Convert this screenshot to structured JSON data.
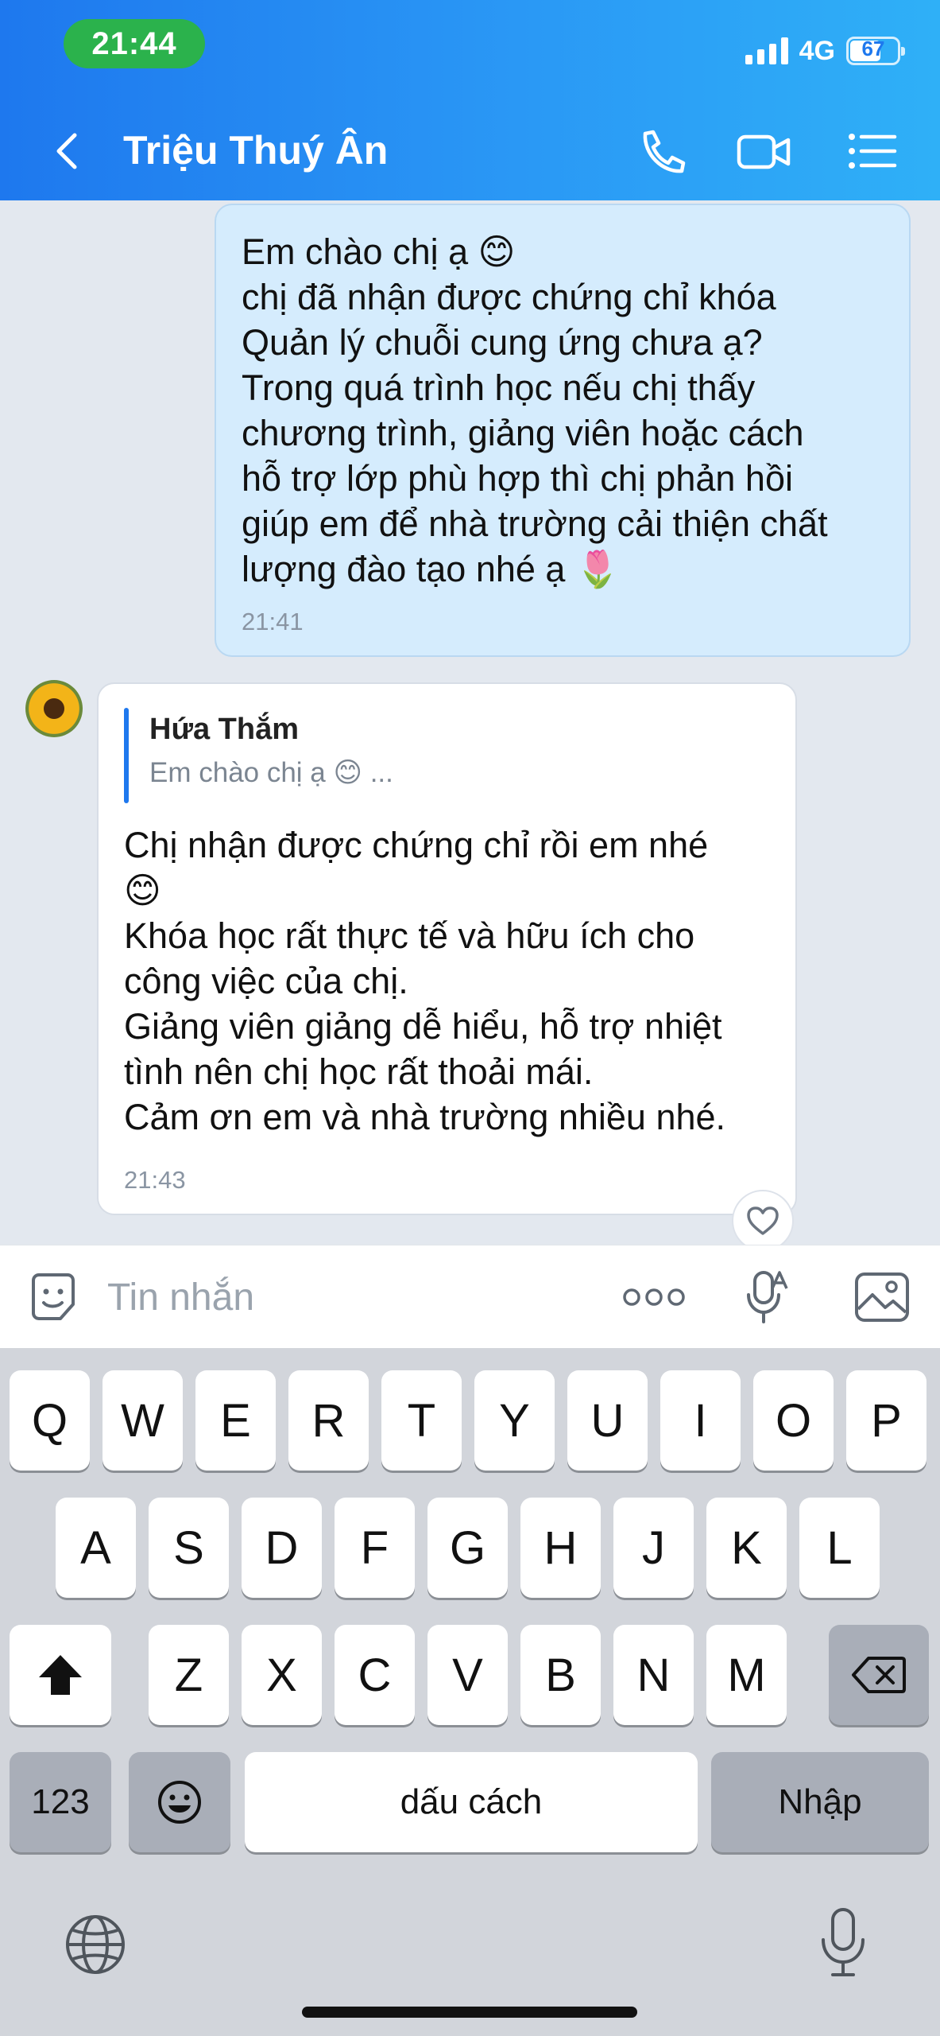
{
  "status_bar": {
    "time": "21:44",
    "network": "4G",
    "battery": "67"
  },
  "header": {
    "contact_name": "Triệu Thuý Ân"
  },
  "messages": {
    "outgoing": {
      "text": "Em chào chị ạ 😊\nchị đã nhận được chứng chỉ khóa\nQuản lý chuỗi cung ứng chưa ạ?\nTrong quá trình học nếu chị thấy\nchương trình, giảng viên hoặc cách\nhỗ trợ lớp phù hợp thì chị phản hồi\ngiúp em để nhà trường cải thiện chất\nlượng đào tạo nhé ạ 🌷",
      "time": "21:41"
    },
    "incoming": {
      "quote_name": "Hứa Thắm",
      "quote_text": "Em chào chị ạ 😊 ...",
      "text": "Chị nhận được chứng chỉ rồi em nhé\n😊\nKhóa học rất thực tế và hữu ích cho\ncông việc của chị.\nGiảng viên giảng dễ hiểu, hỗ trợ nhiệt\ntình nên chị học rất thoải mái.\nCảm ơn em và nhà trường nhiều nhé.",
      "time": "21:43"
    }
  },
  "input": {
    "placeholder": "Tin nhắn"
  },
  "keyboard": {
    "row1": [
      "Q",
      "W",
      "E",
      "R",
      "T",
      "Y",
      "U",
      "I",
      "O",
      "P"
    ],
    "row2": [
      "A",
      "S",
      "D",
      "F",
      "G",
      "H",
      "J",
      "K",
      "L"
    ],
    "row3": [
      "Z",
      "X",
      "C",
      "V",
      "B",
      "N",
      "M"
    ],
    "numbers_key": "123",
    "space_key": "dấu cách",
    "return_key": "Nhập"
  },
  "icons": {
    "back": "chevron-left-icon",
    "call": "phone-icon",
    "video": "video-icon",
    "menu": "list-icon",
    "sticker": "sticker-icon",
    "more": "more-icon",
    "voice": "voice-text-icon",
    "image": "image-icon",
    "like": "heart-icon",
    "shift": "shift-icon",
    "delete": "backspace-icon",
    "emoji": "emoji-icon",
    "globe": "globe-icon",
    "dictation": "microphone-icon"
  },
  "colors": {
    "header_start": "#1e78ee",
    "header_end": "#2fb0f7",
    "outgoing_bubble": "#d5ecfd",
    "time_pill": "#2bb24c"
  }
}
